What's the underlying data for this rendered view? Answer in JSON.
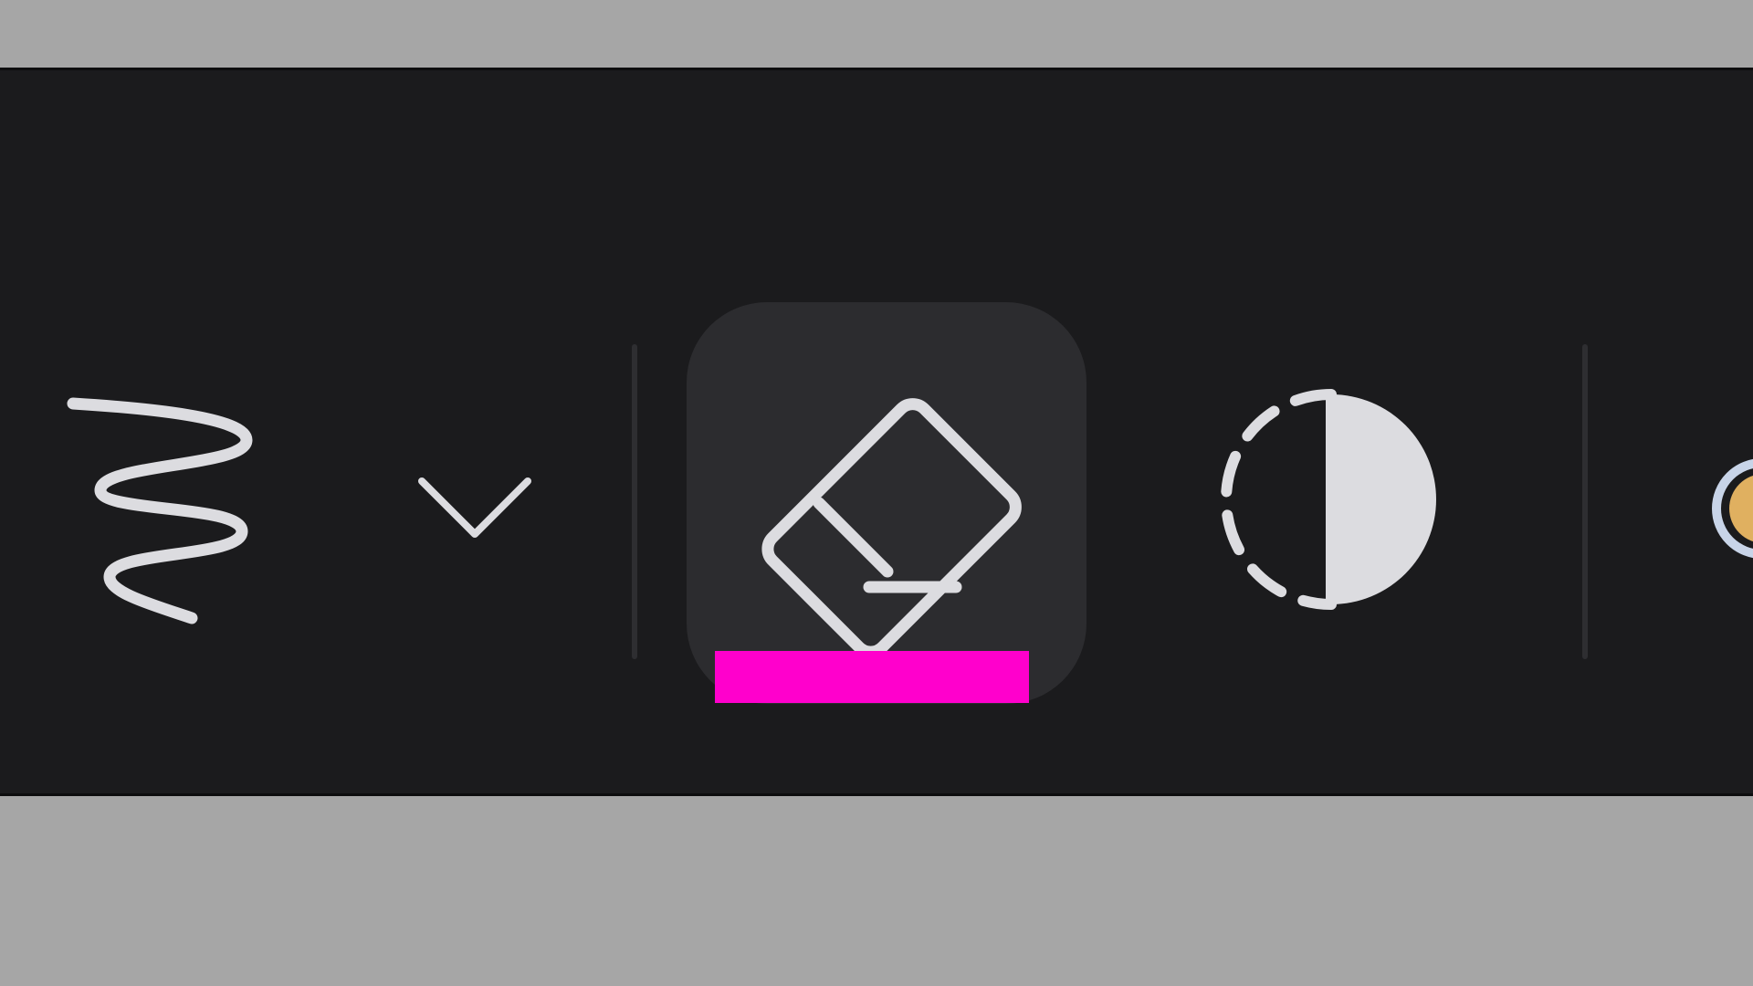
{
  "toolbar": {
    "tools": [
      {
        "id": "scribble",
        "icon": "scribble-icon"
      },
      {
        "id": "dropdown",
        "icon": "chevron-down-icon"
      },
      {
        "id": "eraser",
        "icon": "eraser-icon",
        "active": true
      },
      {
        "id": "contrast",
        "icon": "contrast-icon"
      },
      {
        "id": "partial",
        "icon": "partial-tool-icon"
      }
    ],
    "active_tool": "eraser"
  },
  "colors": {
    "background": "#a6a6a6",
    "toolbar_bg": "#1b1b1d",
    "active_tile_bg": "#2c2c2f",
    "icon": "#dcdce0",
    "accent": "#ff00cc",
    "divider": "#2e2e31"
  }
}
